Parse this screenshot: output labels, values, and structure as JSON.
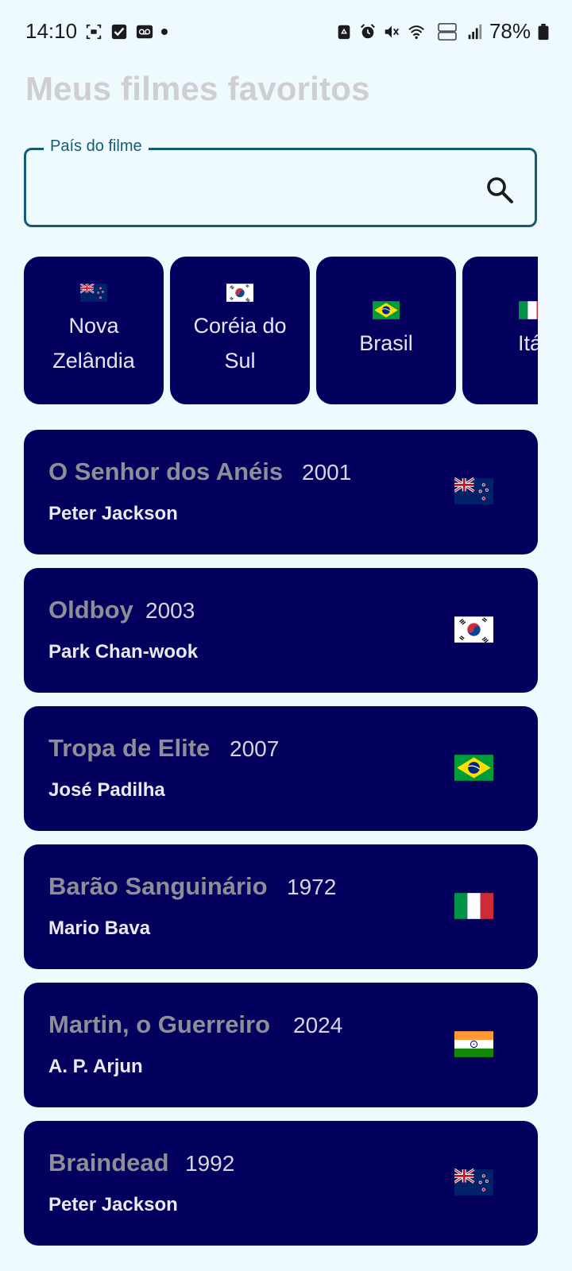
{
  "status_bar": {
    "time": "14:10",
    "battery": "78%"
  },
  "header": {
    "title": "Meus filmes favoritos"
  },
  "search": {
    "label": "País do filme",
    "value": "",
    "icon": "search-icon"
  },
  "countries": [
    {
      "label_line1": "Nova",
      "label_line2": "Zelândia",
      "flag": "new-zealand-flag-icon"
    },
    {
      "label_line1": "Coréia do",
      "label_line2": "Sul",
      "flag": "south-korea-flag-icon"
    },
    {
      "label_line1": "Brasil",
      "label_line2": "",
      "flag": "brazil-flag-icon"
    },
    {
      "label_line1": "Itál",
      "label_line2": "",
      "flag": "italy-flag-icon"
    }
  ],
  "movies": [
    {
      "title": "O Senhor dos Anéis",
      "year": "2001",
      "director": "Peter Jackson",
      "flag": "new-zealand-flag-icon"
    },
    {
      "title": "Oldboy",
      "year": "2003",
      "director": "Park Chan-wook",
      "flag": "south-korea-flag-icon"
    },
    {
      "title": "Tropa de Elite",
      "year": "2007",
      "director": "José Padilha",
      "flag": "brazil-flag-icon"
    },
    {
      "title": "Barão Sanguinário",
      "year": "1972",
      "director": "Mario Bava",
      "flag": "italy-flag-icon"
    },
    {
      "title": "Martin, o Guerreiro",
      "year": "2024",
      "director": "A. P. Arjun",
      "flag": "india-flag-icon"
    },
    {
      "title": "Braindead",
      "year": "1992",
      "director": "Peter Jackson",
      "flag": "new-zealand-flag-icon"
    }
  ],
  "colors": {
    "card_bg": "#03005e",
    "accent": "#115d78",
    "background": "#eefafd"
  }
}
